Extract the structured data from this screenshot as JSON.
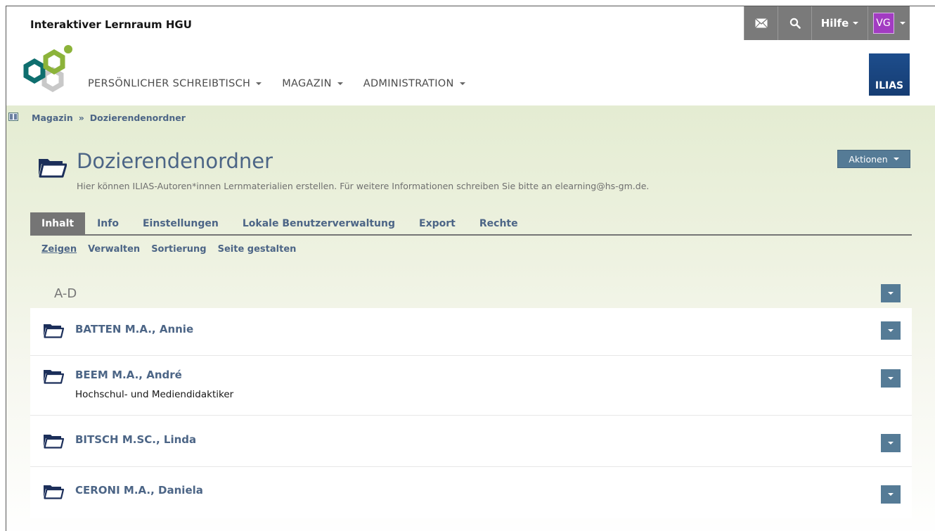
{
  "header": {
    "site_title": "Interaktiver Lernraum HGU",
    "help_label": "Hilfe",
    "user_initials": "VG",
    "ilias_logo_text": "ILIAS",
    "colors": {
      "topbar": "#7a7a7a",
      "avatar": "#a23cc2",
      "link": "#4c6586",
      "button": "#557b96"
    }
  },
  "mainnav": {
    "items": [
      {
        "label": "PERSÖNLICHER SCHREIBTISCH"
      },
      {
        "label": "MAGAZIN"
      },
      {
        "label": "ADMINISTRATION"
      }
    ]
  },
  "breadcrumb": {
    "items": [
      "Magazin",
      "Dozierendenordner"
    ],
    "separator": "»"
  },
  "page": {
    "title": "Dozierendenordner",
    "description": "Hier können ILIAS-Autoren*innen Lernmaterialien erstellen. Für weitere Informationen schreiben Sie bitte an elearning@hs-gm.de.",
    "actions_label": "Aktionen"
  },
  "tabs": [
    {
      "label": "Inhalt",
      "active": true
    },
    {
      "label": "Info"
    },
    {
      "label": "Einstellungen"
    },
    {
      "label": "Lokale Benutzerverwaltung"
    },
    {
      "label": "Export"
    },
    {
      "label": "Rechte"
    }
  ],
  "subtabs": [
    {
      "label": "Zeigen",
      "active": true
    },
    {
      "label": "Verwalten"
    },
    {
      "label": "Sortierung"
    },
    {
      "label": "Seite gestalten"
    }
  ],
  "group": {
    "label": "A-D"
  },
  "items": [
    {
      "title": "BATTEN M.A., Annie",
      "description": ""
    },
    {
      "title": "BEEM M.A., André",
      "description": "Hochschul- und Mediendidaktiker"
    },
    {
      "title": "BITSCH M.SC., Linda",
      "description": ""
    },
    {
      "title": "CERONI M.A., Daniela",
      "description": ""
    }
  ]
}
